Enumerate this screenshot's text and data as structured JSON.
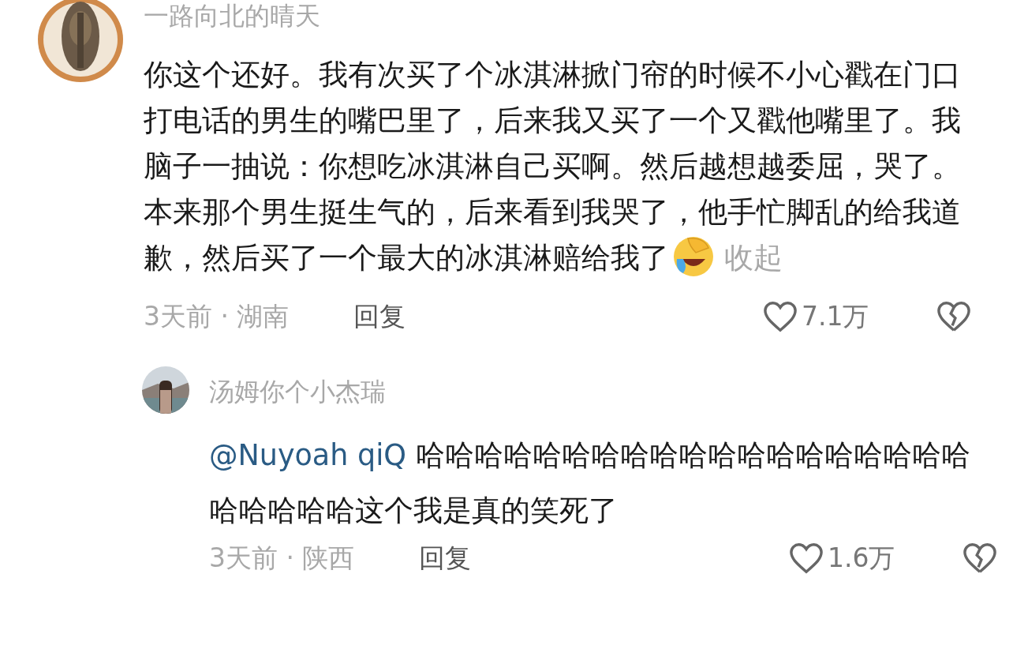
{
  "comment": {
    "author": "一路向北的晴天",
    "text": "你这个还好。我有次买了个冰淇淋掀门帘的时候不小心戳在门口打电话的男生的嘴巴里了，后来我又买了一个又戳他嘴里了。我脑子一抽说：你想吃冰淇淋自己买啊。然后越想越委屈，哭了。本来那个男生挺生气的，后来看到我哭了，他手忙脚乱的给我道歉，然后买了一个最大的冰淇淋赔给我了",
    "collapse": "收起",
    "meta": "3天前 · 湖南",
    "reply_label": "回复",
    "likes": "7.1万",
    "liked": false
  },
  "reply": {
    "author": "汤姆你个小杰瑞",
    "mention": "@Nuyoah qiQ",
    "text": "哈哈哈哈哈哈哈哈哈哈哈哈哈哈哈哈哈哈哈哈哈哈哈哈这个我是真的笑死了",
    "meta": "3天前 · 陕西",
    "reply_label": "回复",
    "likes": "1.6万",
    "liked": false
  }
}
